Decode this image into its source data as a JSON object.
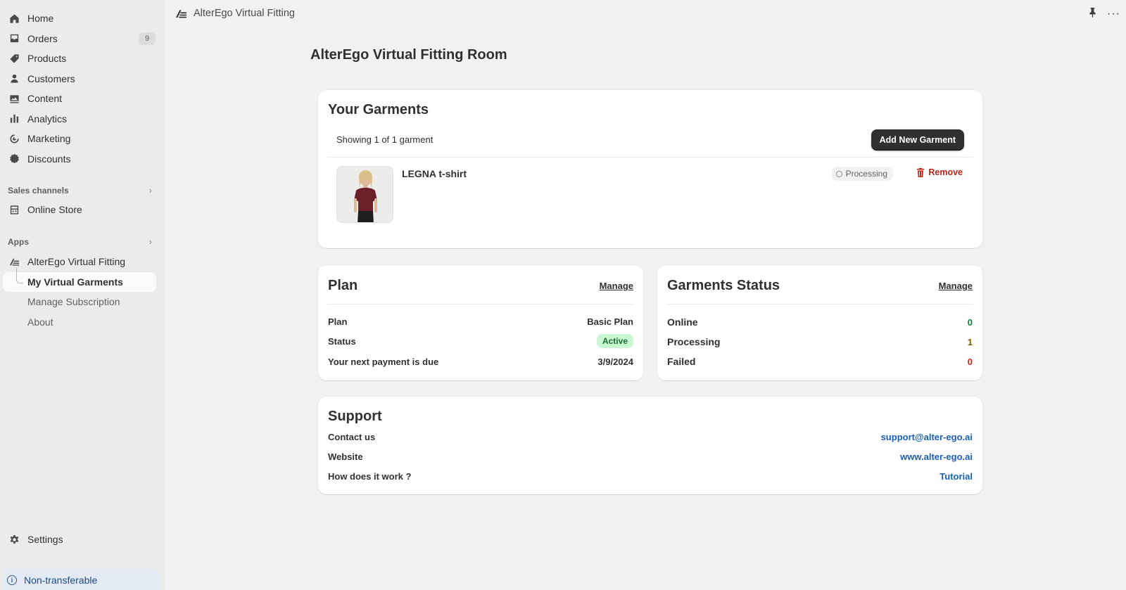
{
  "nav": {
    "items": [
      {
        "label": "Home",
        "icon": "home-icon"
      },
      {
        "label": "Orders",
        "icon": "inbox-icon",
        "badge": "9"
      },
      {
        "label": "Products",
        "icon": "tag-icon"
      },
      {
        "label": "Customers",
        "icon": "person-icon"
      },
      {
        "label": "Content",
        "icon": "image-icon"
      },
      {
        "label": "Analytics",
        "icon": "bar-chart-icon"
      },
      {
        "label": "Marketing",
        "icon": "target-icon"
      },
      {
        "label": "Discounts",
        "icon": "discount-icon"
      }
    ],
    "sales_channels": {
      "heading": "Sales channels",
      "items": [
        {
          "label": "Online Store",
          "icon": "store-icon"
        }
      ]
    },
    "apps": {
      "heading": "Apps",
      "app_name": "AlterEgo Virtual Fitting",
      "sub_items": [
        "My Virtual Garments",
        "Manage Subscription",
        "About"
      ]
    },
    "settings": "Settings",
    "nontransferable": "Non-transferable"
  },
  "topbar": {
    "title": "AlterEgo Virtual Fitting"
  },
  "page": {
    "title": "AlterEgo Virtual Fitting Room"
  },
  "garments": {
    "title": "Your Garments",
    "showing": "Showing 1 of 1 garment",
    "add_button": "Add New Garment",
    "items": [
      {
        "name": "LEGNA t-shirt",
        "status": "Processing",
        "remove": "Remove"
      }
    ]
  },
  "plan": {
    "title": "Plan",
    "manage": "Manage",
    "rows": [
      {
        "label": "Plan",
        "value": "Basic Plan"
      },
      {
        "label": "Status",
        "value": "Active"
      },
      {
        "label": "Your next payment is due",
        "value": "3/9/2024"
      }
    ]
  },
  "garments_status": {
    "title": "Garments Status",
    "manage": "Manage",
    "rows": [
      {
        "label": "Online",
        "value": "0"
      },
      {
        "label": "Processing",
        "value": "1"
      },
      {
        "label": "Failed",
        "value": "0"
      }
    ]
  },
  "support": {
    "title": "Support",
    "rows": [
      {
        "label": "Contact us",
        "value": "support@alter-ego.ai"
      },
      {
        "label": "Website",
        "value": "www.alter-ego.ai"
      },
      {
        "label": "How does it work ?",
        "value": "Tutorial"
      }
    ]
  },
  "colors": {
    "active_badge_bg": "#c8f7d2",
    "link": "#1a5fb4",
    "remove": "#c5281c",
    "sidebar_bg": "#ebebeb",
    "page_bg": "#f1f1f1"
  }
}
